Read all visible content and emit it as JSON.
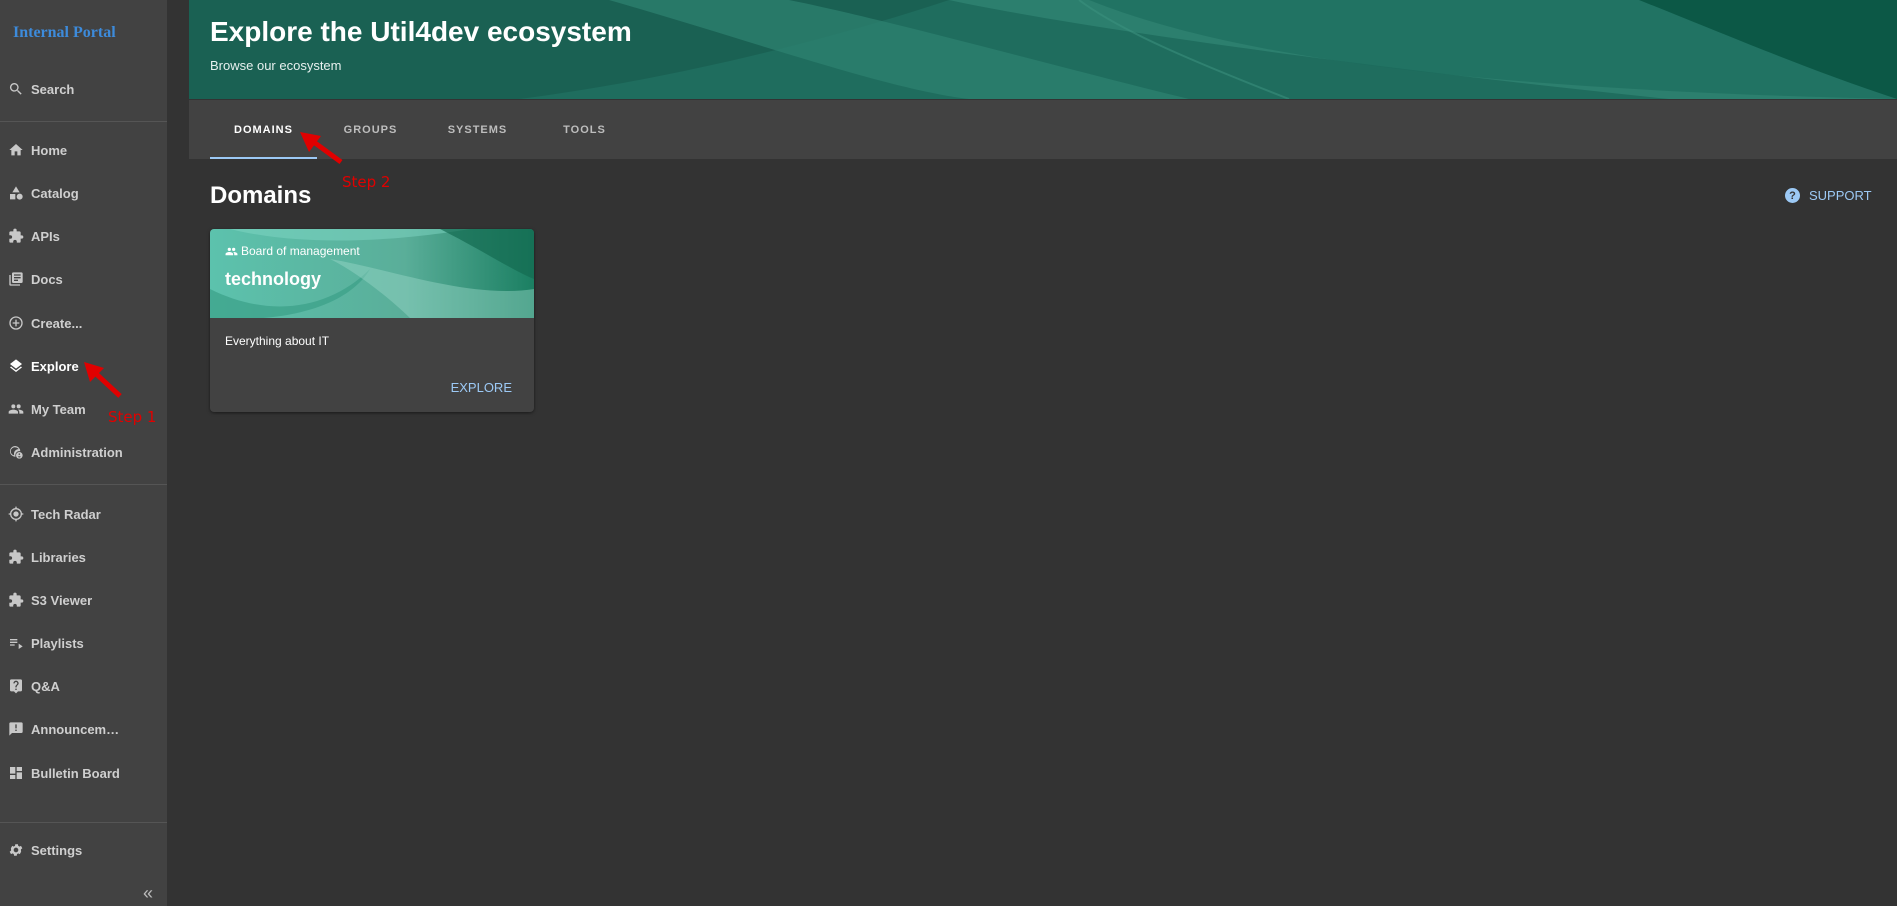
{
  "app": {
    "title": "Internal Portal"
  },
  "sidebar": {
    "search_label": "Search",
    "items": [
      {
        "label": "Home",
        "icon": "home-icon"
      },
      {
        "label": "Catalog",
        "icon": "catalog-icon"
      },
      {
        "label": "APIs",
        "icon": "puzzle-icon"
      },
      {
        "label": "Docs",
        "icon": "docs-icon"
      },
      {
        "label": "Create...",
        "icon": "add-circle-icon"
      },
      {
        "label": "Explore",
        "icon": "layers-icon"
      },
      {
        "label": "My Team",
        "icon": "people-icon"
      },
      {
        "label": "Administration",
        "icon": "admin-icon"
      },
      {
        "label": "Tech Radar",
        "icon": "radar-icon"
      },
      {
        "label": "Libraries",
        "icon": "puzzle-icon"
      },
      {
        "label": "S3 Viewer",
        "icon": "puzzle-icon"
      },
      {
        "label": "Playlists",
        "icon": "playlist-icon"
      },
      {
        "label": "Q&A",
        "icon": "question-icon"
      },
      {
        "label": "Announcem…",
        "icon": "announcement-icon"
      },
      {
        "label": "Bulletin Board",
        "icon": "dashboard-icon"
      }
    ],
    "settings_label": "Settings",
    "collapse_label": "«"
  },
  "header": {
    "title": "Explore the Util4dev ecosystem",
    "subtitle": "Browse our ecosystem"
  },
  "tabs": [
    {
      "label": "DOMAINS",
      "active": true
    },
    {
      "label": "GROUPS",
      "active": false
    },
    {
      "label": "SYSTEMS",
      "active": false
    },
    {
      "label": "TOOLS",
      "active": false
    }
  ],
  "main": {
    "section_title": "Domains",
    "support_label": "SUPPORT",
    "cards": [
      {
        "type_label": "Board of management",
        "title": "technology",
        "description": "Everything about IT",
        "action_label": "EXPLORE"
      }
    ]
  },
  "annotations": {
    "step1": "Step 1",
    "step2": "Step 2",
    "color": "#e00000"
  }
}
